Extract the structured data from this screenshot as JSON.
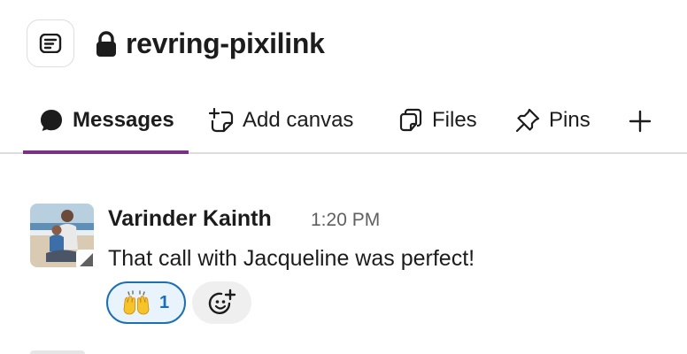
{
  "header": {
    "channel_name": "revring-pixilink",
    "menu_icon": "sidebar-menu-icon",
    "privacy_icon": "lock-icon"
  },
  "tabs": [
    {
      "label": "Messages",
      "icon": "message-bubble-icon",
      "active": true
    },
    {
      "label": "Add canvas",
      "icon": "add-canvas-icon",
      "active": false
    },
    {
      "label": "Files",
      "icon": "files-icon",
      "active": false
    },
    {
      "label": "Pins",
      "icon": "pin-icon",
      "active": false
    }
  ],
  "tab_add_icon": "plus-icon",
  "message": {
    "sender": "Varinder Kainth",
    "time": "1:20 PM",
    "text": "That call with Jacqueline was perfect!",
    "reactions": [
      {
        "emoji": "raised-hands",
        "count": "1",
        "reacted_by_me": true
      }
    ],
    "add_reaction_icon": "add-emoji-icon"
  },
  "colors": {
    "active_tab_underline": "#7c3085",
    "reaction_border": "#1d6fb5",
    "reaction_bg": "#e8f3fb",
    "timestamp": "#616061"
  }
}
